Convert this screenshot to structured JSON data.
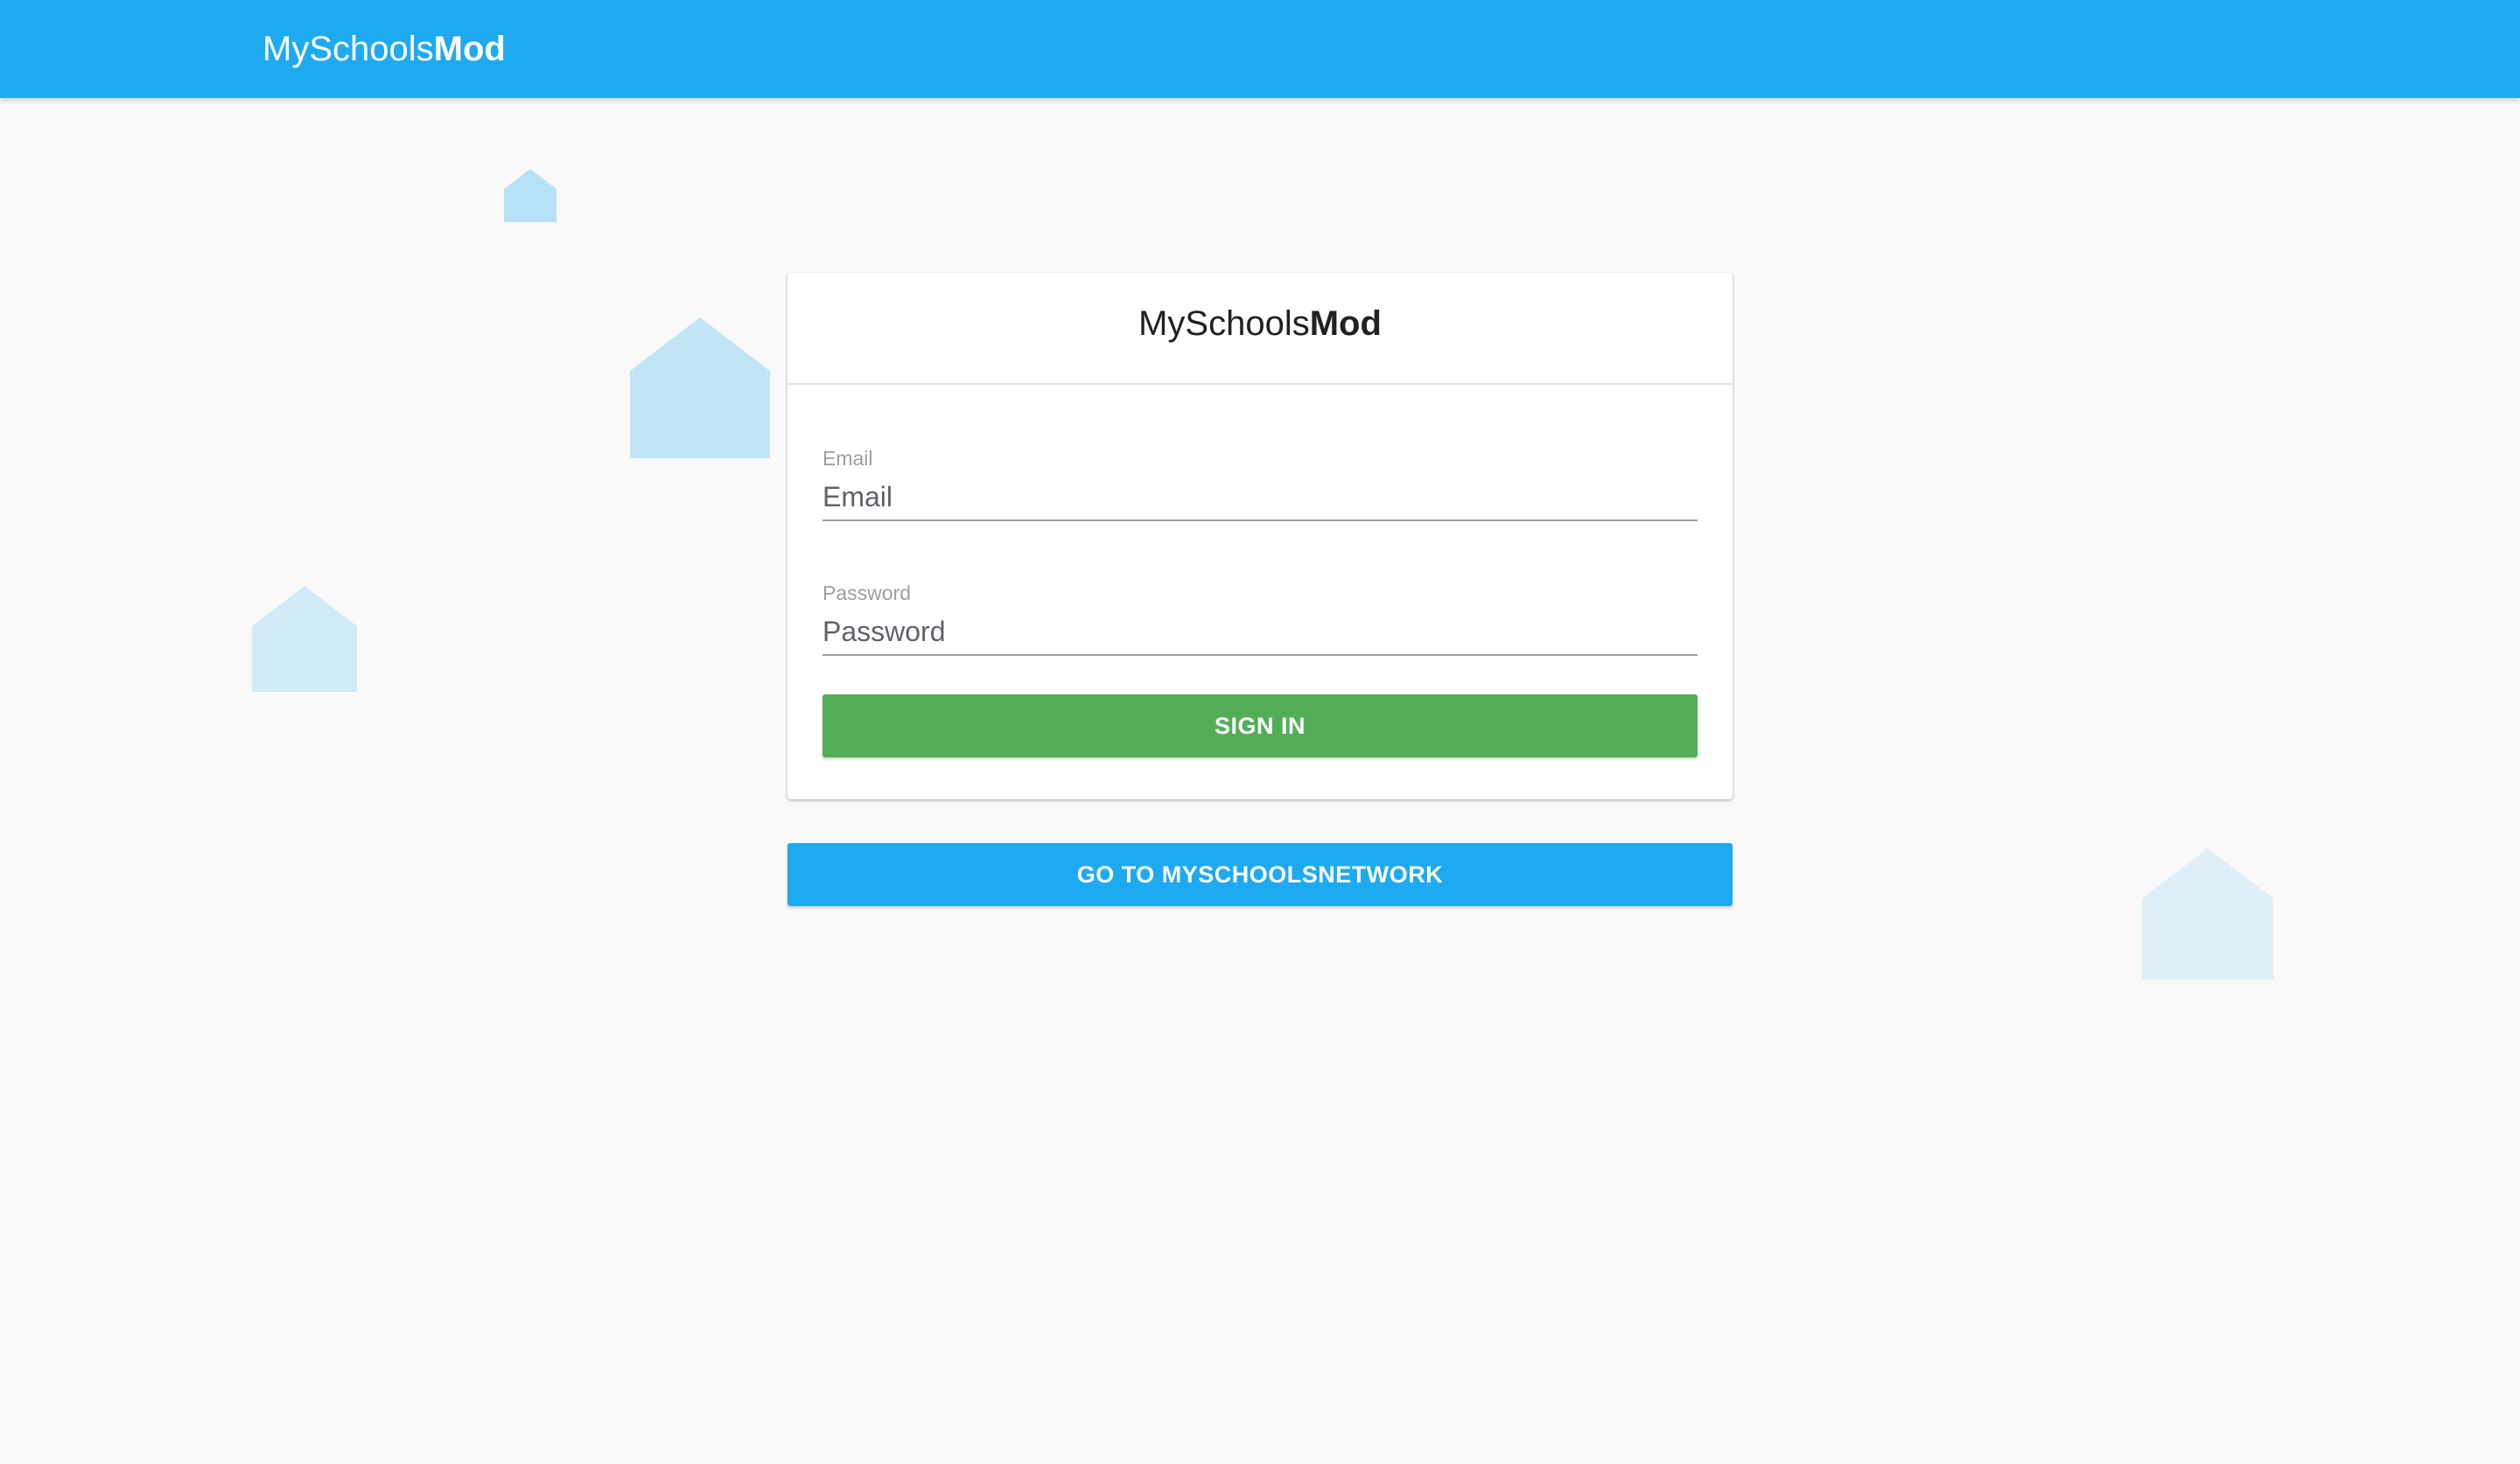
{
  "header": {
    "brand_light": "MySchools",
    "brand_bold": "Mod"
  },
  "login_card": {
    "title_light": "MySchools",
    "title_bold": "Mod",
    "email": {
      "label": "Email",
      "placeholder": "Email",
      "value": ""
    },
    "password": {
      "label": "Password",
      "placeholder": "Password",
      "value": ""
    },
    "sign_in_label": "SIGN IN"
  },
  "network_button_label": "GO TO MYSCHOOLSNETWORK",
  "colors": {
    "primary": "#1eaaf1",
    "success": "#51ae56",
    "background": "#f9f9f9",
    "house_decoration": "#a9d8f5"
  },
  "icons": {
    "decoration": "house-icon"
  }
}
